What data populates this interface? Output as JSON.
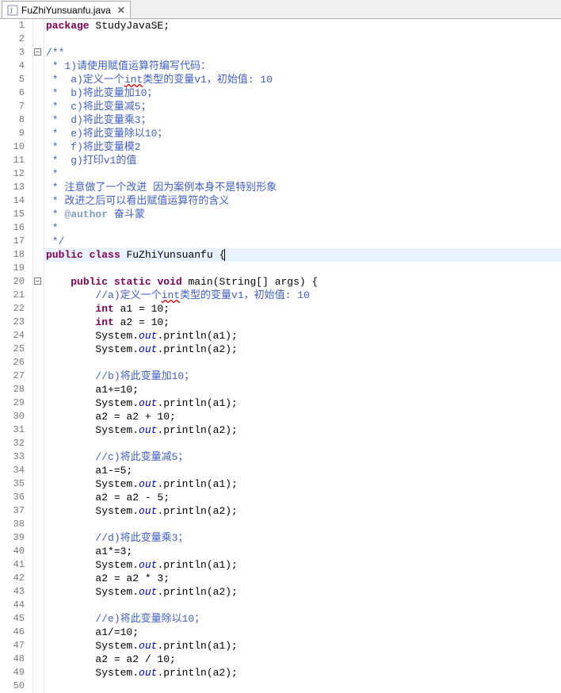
{
  "tab": {
    "title": "FuZhiYunsuanfu.java",
    "close": "✕"
  },
  "lines": [
    {
      "n": 1,
      "seg": [
        {
          "c": "kw",
          "t": "package"
        },
        {
          "t": " StudyJavaSE;"
        }
      ]
    },
    {
      "n": 2,
      "seg": []
    },
    {
      "n": 3,
      "fold": true,
      "seg": [
        {
          "c": "cmt",
          "t": "/**"
        }
      ]
    },
    {
      "n": 4,
      "seg": [
        {
          "c": "cmt",
          "t": " * 1)请使用赋值运算符编写代码："
        }
      ]
    },
    {
      "n": 5,
      "seg": [
        {
          "c": "cmt",
          "t": " *  a)定义一个"
        },
        {
          "c": "cmt err",
          "t": "int"
        },
        {
          "c": "cmt",
          "t": "类型的变量v1，初始值: 10"
        }
      ]
    },
    {
      "n": 6,
      "seg": [
        {
          "c": "cmt",
          "t": " *  b)将此变量加10；"
        }
      ]
    },
    {
      "n": 7,
      "seg": [
        {
          "c": "cmt",
          "t": " *  c)将此变量减5；"
        }
      ]
    },
    {
      "n": 8,
      "seg": [
        {
          "c": "cmt",
          "t": " *  d)将此变量乘3；"
        }
      ]
    },
    {
      "n": 9,
      "seg": [
        {
          "c": "cmt",
          "t": " *  e)将此变量除以10；"
        }
      ]
    },
    {
      "n": 10,
      "seg": [
        {
          "c": "cmt",
          "t": " *  f)将此变量模2"
        }
      ]
    },
    {
      "n": 11,
      "seg": [
        {
          "c": "cmt",
          "t": " *  g)打印v1的值"
        }
      ]
    },
    {
      "n": 12,
      "seg": [
        {
          "c": "cmt",
          "t": " *  "
        }
      ]
    },
    {
      "n": 13,
      "seg": [
        {
          "c": "cmt",
          "t": " * 注意做了一个改进 因为案例本身不是特别形象"
        }
      ]
    },
    {
      "n": 14,
      "seg": [
        {
          "c": "cmt",
          "t": " * 改进之后可以看出赋值运算符的含义"
        }
      ]
    },
    {
      "n": 15,
      "seg": [
        {
          "c": "cmt",
          "t": " * "
        },
        {
          "c": "tag",
          "t": "@author"
        },
        {
          "c": "cmt",
          "t": " 奋斗蒙"
        }
      ]
    },
    {
      "n": 16,
      "seg": [
        {
          "c": "cmt",
          "t": " *"
        }
      ]
    },
    {
      "n": 17,
      "seg": [
        {
          "c": "cmt",
          "t": " */"
        }
      ]
    },
    {
      "n": 18,
      "hl": true,
      "seg": [
        {
          "c": "kw",
          "t": "public"
        },
        {
          "t": " "
        },
        {
          "c": "kw",
          "t": "class"
        },
        {
          "t": " FuZhiYunsuanfu {"
        },
        {
          "cursor": true
        }
      ]
    },
    {
      "n": 19,
      "seg": []
    },
    {
      "n": 20,
      "fold": true,
      "seg": [
        {
          "t": "    "
        },
        {
          "c": "kw",
          "t": "public"
        },
        {
          "t": " "
        },
        {
          "c": "kw",
          "t": "static"
        },
        {
          "t": " "
        },
        {
          "c": "kw",
          "t": "void"
        },
        {
          "t": " main(String[] args) {"
        }
      ]
    },
    {
      "n": 21,
      "seg": [
        {
          "t": "        "
        },
        {
          "c": "cmt",
          "t": "//a)定义一个"
        },
        {
          "c": "cmt err",
          "t": "int"
        },
        {
          "c": "cmt",
          "t": "类型的变量v1，初始值: 10"
        }
      ]
    },
    {
      "n": 22,
      "seg": [
        {
          "t": "        "
        },
        {
          "c": "kw",
          "t": "int"
        },
        {
          "t": " a1 = 10;"
        }
      ]
    },
    {
      "n": 23,
      "seg": [
        {
          "t": "        "
        },
        {
          "c": "kw",
          "t": "int"
        },
        {
          "t": " a2 = 10;"
        }
      ]
    },
    {
      "n": 24,
      "seg": [
        {
          "t": "        System."
        },
        {
          "c": "str-id",
          "t": "out"
        },
        {
          "t": ".println(a1);"
        }
      ]
    },
    {
      "n": 25,
      "seg": [
        {
          "t": "        System."
        },
        {
          "c": "str-id",
          "t": "out"
        },
        {
          "t": ".println(a2);"
        }
      ]
    },
    {
      "n": 26,
      "seg": [
        {
          "t": "        "
        }
      ]
    },
    {
      "n": 27,
      "seg": [
        {
          "t": "        "
        },
        {
          "c": "cmt",
          "t": "//b)将此变量加10；"
        }
      ]
    },
    {
      "n": 28,
      "seg": [
        {
          "t": "        a1+=10;"
        }
      ]
    },
    {
      "n": 29,
      "seg": [
        {
          "t": "        System."
        },
        {
          "c": "str-id",
          "t": "out"
        },
        {
          "t": ".println(a1);"
        }
      ]
    },
    {
      "n": 30,
      "seg": [
        {
          "t": "        a2 = a2 + 10;"
        }
      ]
    },
    {
      "n": 31,
      "seg": [
        {
          "t": "        System."
        },
        {
          "c": "str-id",
          "t": "out"
        },
        {
          "t": ".println(a2);"
        }
      ]
    },
    {
      "n": 32,
      "seg": [
        {
          "t": "        "
        }
      ]
    },
    {
      "n": 33,
      "seg": [
        {
          "t": "        "
        },
        {
          "c": "cmt",
          "t": "//c)将此变量减5；"
        }
      ]
    },
    {
      "n": 34,
      "seg": [
        {
          "t": "        a1-=5;"
        }
      ]
    },
    {
      "n": 35,
      "seg": [
        {
          "t": "        System."
        },
        {
          "c": "str-id",
          "t": "out"
        },
        {
          "t": ".println(a1);"
        }
      ]
    },
    {
      "n": 36,
      "seg": [
        {
          "t": "        a2 = a2 - 5;"
        }
      ]
    },
    {
      "n": 37,
      "seg": [
        {
          "t": "        System."
        },
        {
          "c": "str-id",
          "t": "out"
        },
        {
          "t": ".println(a2);"
        }
      ]
    },
    {
      "n": 38,
      "seg": [
        {
          "t": "        "
        }
      ]
    },
    {
      "n": 39,
      "seg": [
        {
          "t": "        "
        },
        {
          "c": "cmt",
          "t": "//d)将此变量乘3；"
        }
      ]
    },
    {
      "n": 40,
      "seg": [
        {
          "t": "        a1*=3;"
        }
      ]
    },
    {
      "n": 41,
      "seg": [
        {
          "t": "        System."
        },
        {
          "c": "str-id",
          "t": "out"
        },
        {
          "t": ".println(a1);"
        }
      ]
    },
    {
      "n": 42,
      "seg": [
        {
          "t": "        a2 = a2 * 3;"
        }
      ]
    },
    {
      "n": 43,
      "seg": [
        {
          "t": "        System."
        },
        {
          "c": "str-id",
          "t": "out"
        },
        {
          "t": ".println(a2);"
        }
      ]
    },
    {
      "n": 44,
      "seg": [
        {
          "t": "        "
        }
      ]
    },
    {
      "n": 45,
      "seg": [
        {
          "t": "        "
        },
        {
          "c": "cmt",
          "t": "//e)将此变量除以10；"
        }
      ]
    },
    {
      "n": 46,
      "seg": [
        {
          "t": "        a1/=10;"
        }
      ]
    },
    {
      "n": 47,
      "seg": [
        {
          "t": "        System."
        },
        {
          "c": "str-id",
          "t": "out"
        },
        {
          "t": ".println(a1);"
        }
      ]
    },
    {
      "n": 48,
      "seg": [
        {
          "t": "        a2 = a2 / 10;"
        }
      ]
    },
    {
      "n": 49,
      "seg": [
        {
          "t": "        System."
        },
        {
          "c": "str-id",
          "t": "out"
        },
        {
          "t": ".println(a2);"
        }
      ]
    },
    {
      "n": 50,
      "seg": [
        {
          "t": "        "
        }
      ]
    }
  ]
}
